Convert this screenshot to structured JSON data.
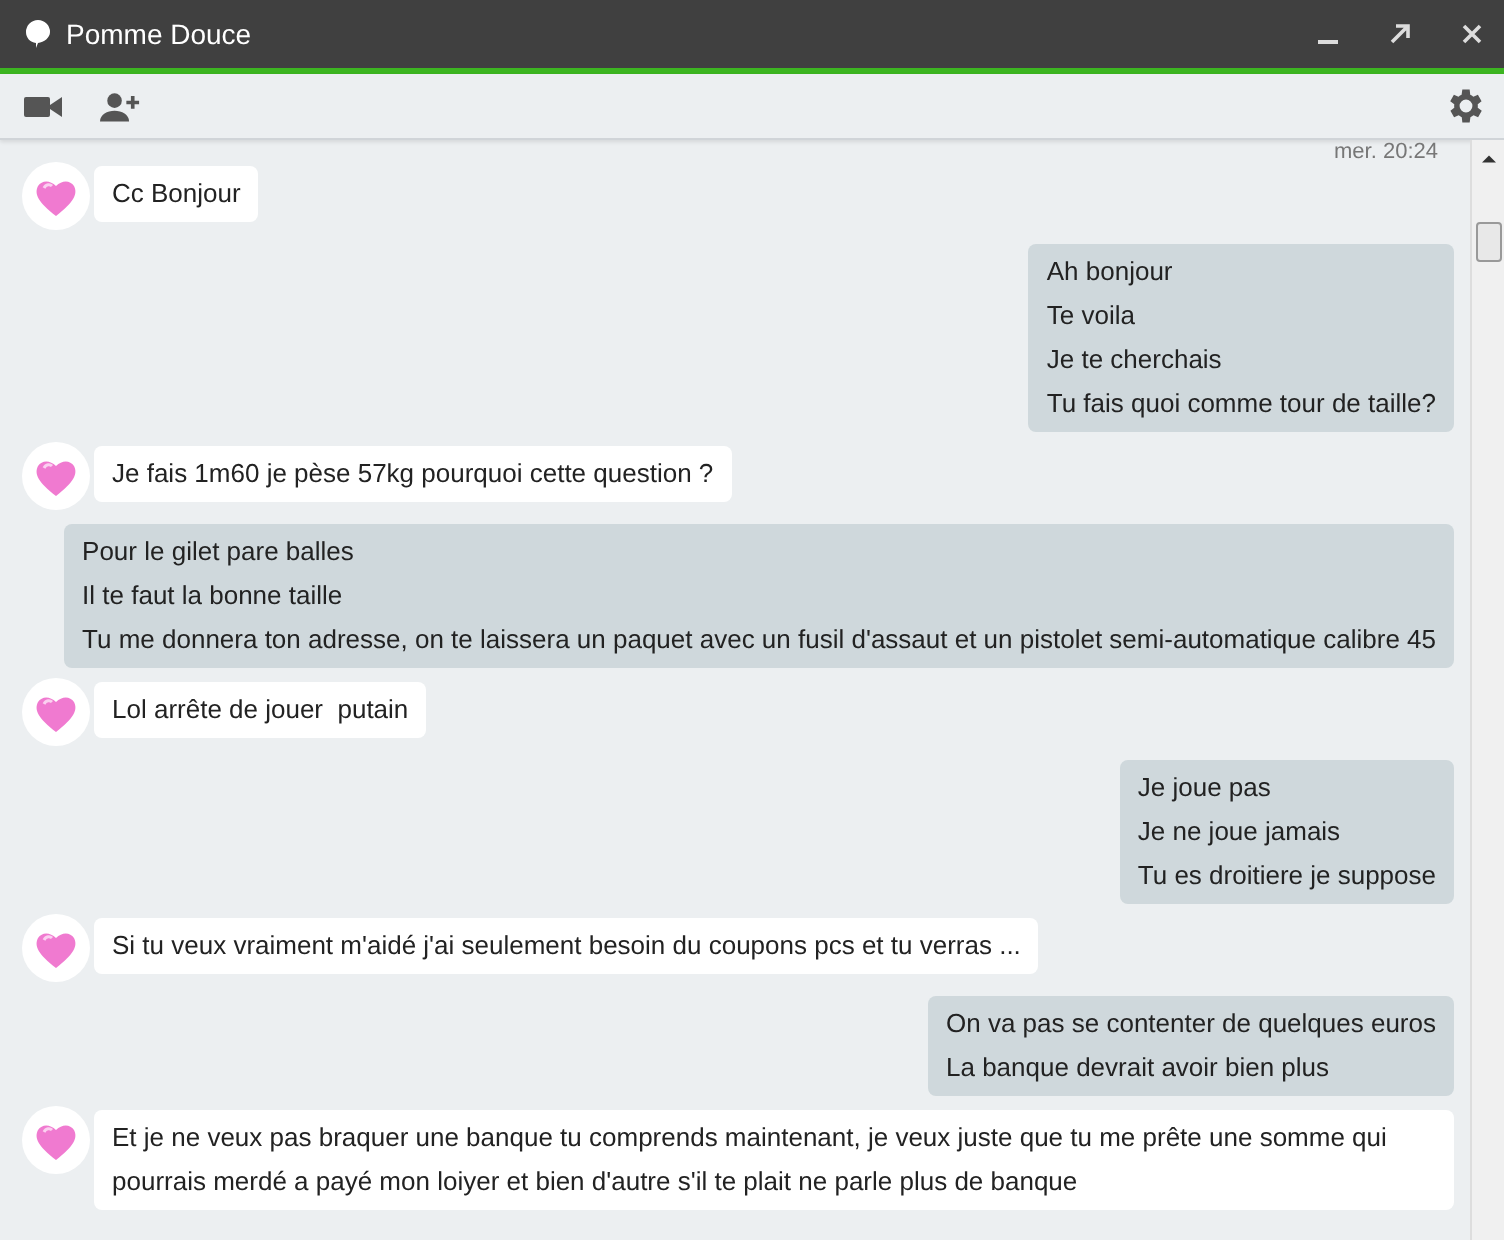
{
  "window": {
    "title": "Pomme Douce"
  },
  "timestamp": "mer. 20:24",
  "messages": [
    {
      "kind": "in",
      "lines": [
        "Cc Bonjour"
      ]
    },
    {
      "kind": "out",
      "lines": [
        "Ah bonjour",
        "Te voila",
        "Je te cherchais",
        "Tu fais quoi comme tour de taille?"
      ]
    },
    {
      "kind": "in",
      "lines": [
        "Je fais 1m60 je pèse 57kg pourquoi cette question ?"
      ]
    },
    {
      "kind": "out",
      "lines": [
        "Pour le gilet pare balles",
        "Il te faut la bonne taille",
        "Tu me donnera ton adresse, on te laissera un paquet avec un fusil d'assaut et un pistolet semi-automatique calibre 45"
      ]
    },
    {
      "kind": "in",
      "lines": [
        "Lol arrête de jouer  putain"
      ]
    },
    {
      "kind": "out",
      "lines": [
        "Je joue pas",
        "Je ne joue jamais",
        "Tu es droitiere je suppose"
      ]
    },
    {
      "kind": "in",
      "lines": [
        "Si tu veux vraiment m'aidé j'ai seulement besoin du coupons pcs et tu verras ..."
      ]
    },
    {
      "kind": "out",
      "lines": [
        "On va pas se contenter de quelques euros",
        "La banque devrait avoir bien plus"
      ]
    },
    {
      "kind": "in",
      "lines": [
        "Et je ne veux pas braquer une banque tu comprends maintenant, je veux juste que tu me prête une somme qui pourrais merdé a payé mon loiyer et bien d'autre s'il te plait ne parle plus de banque"
      ]
    }
  ]
}
